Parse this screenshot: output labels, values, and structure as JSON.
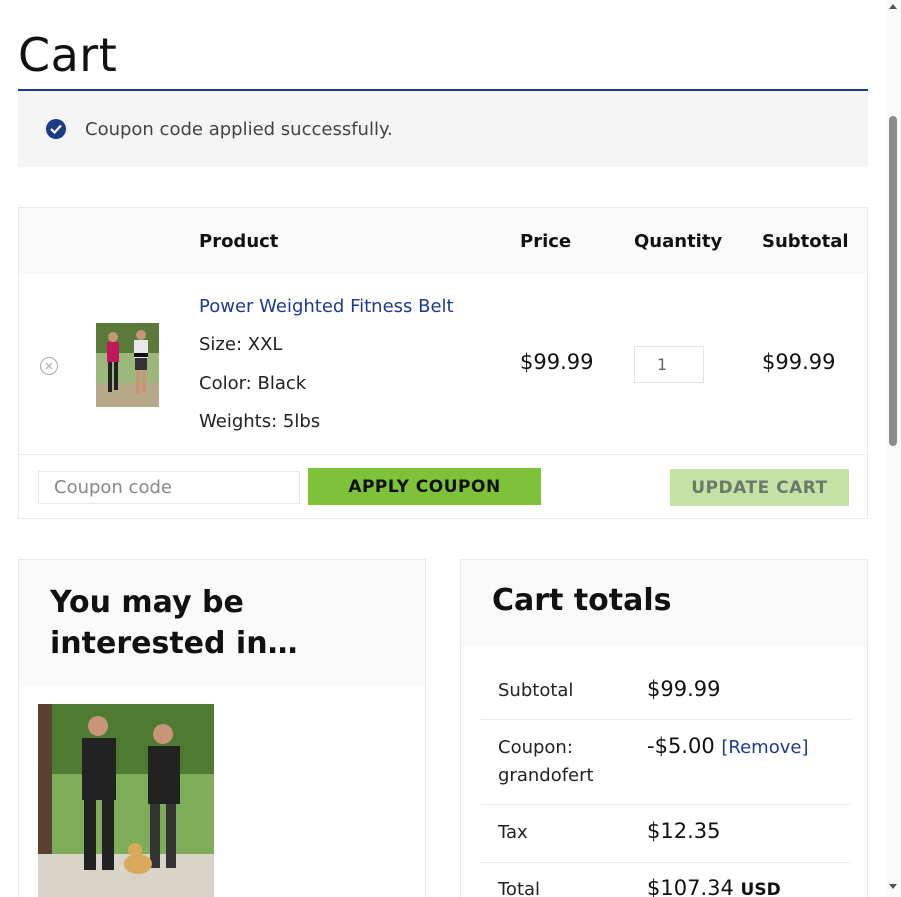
{
  "page": {
    "title": "Cart"
  },
  "notice": {
    "icon": "check-circle-icon",
    "message": "Coupon code applied successfully.",
    "accent_color": "#1e3a8a"
  },
  "cart_table": {
    "headers": {
      "product": "Product",
      "price": "Price",
      "quantity": "Quantity",
      "subtotal": "Subtotal"
    },
    "items": [
      {
        "name": "Power Weighted Fitness Belt",
        "variations": [
          "Size: XXL",
          "Color: Black",
          "Weights: 5lbs"
        ],
        "price": "$99.99",
        "quantity": "1",
        "subtotal": "$99.99",
        "remove_icon": "remove-circle-icon"
      }
    ],
    "coupon_placeholder": "Coupon code",
    "apply_label": "APPLY COUPON",
    "update_label": "UPDATE CART"
  },
  "colors": {
    "link": "#1e3a8a",
    "apply_button": "#7dc238",
    "update_button_disabled": "#c5e2a5"
  },
  "upsell": {
    "title": "You may be interested in…"
  },
  "totals": {
    "title": "Cart totals",
    "subtotal_label": "Subtotal",
    "subtotal_value": "$99.99",
    "coupon_label": "Coupon: grandofert",
    "coupon_value": "-$5.00",
    "coupon_remove": "[Remove]",
    "tax_label": "Tax",
    "tax_value": "$12.35",
    "total_label": "Total",
    "total_value": "$107.34",
    "currency": "USD"
  }
}
